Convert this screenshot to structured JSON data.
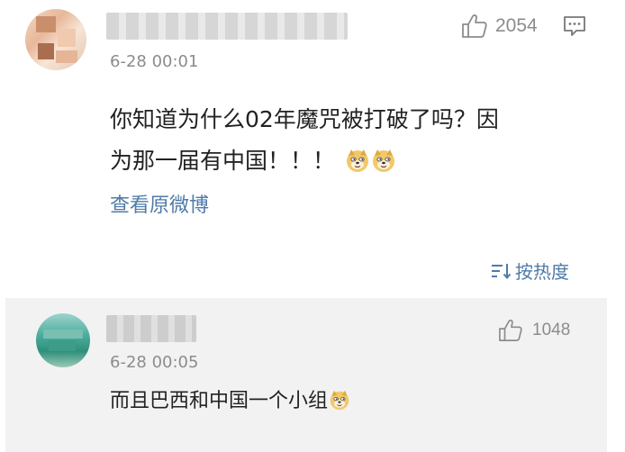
{
  "comments": [
    {
      "timestamp": "6-28 00:01",
      "like_count": "2054",
      "text_line1": "你知道为什么02年魔咒被打破了吗？因",
      "text_line2": "为那一届有中国！！！",
      "emojis": [
        "doge-emoji",
        "doge-emoji"
      ],
      "view_original": "查看原微博"
    },
    {
      "timestamp": "6-28 00:05",
      "like_count": "1048",
      "text": "而且巴西和中国一个小组",
      "emojis": [
        "doge-emoji"
      ]
    }
  ],
  "sort": {
    "label": "按热度"
  },
  "colors": {
    "link": "#4f7ba8",
    "meta": "#8c8c8c",
    "text": "#222222",
    "second_bg": "#f2f2f2"
  }
}
